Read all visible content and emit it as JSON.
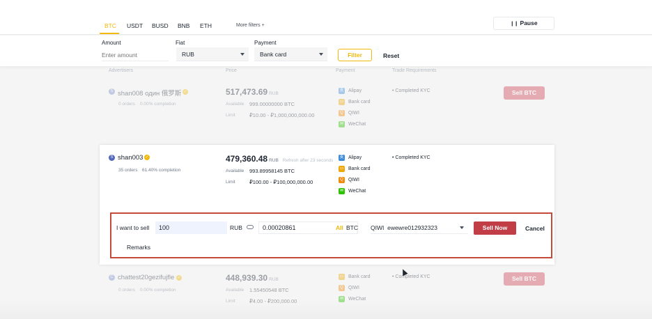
{
  "tabs": [
    "BTC",
    "USDT",
    "BUSD",
    "BNB",
    "ETH"
  ],
  "more_filters": "More filters",
  "pause_label": "Pause",
  "filters": {
    "amount_label": "Amount",
    "amount_placeholder": "Enter amount",
    "fiat_label": "Fiat",
    "fiat_value": "RUB",
    "payment_label": "Payment",
    "payment_value": "Bank card",
    "filter_btn": "Filter",
    "reset_btn": "Reset"
  },
  "columns": {
    "advertisers": "Advertisers",
    "price": "Price",
    "payment": "Payment",
    "trade_requirements": "Trade Requirements"
  },
  "labels": {
    "available": "Available",
    "limit": "Limit",
    "sell_btc": "Sell BTC"
  },
  "listings": [
    {
      "avatar": "S",
      "name": "shan008 один 俄罗斯",
      "orders": "0 orders",
      "completion": "0.00% completion",
      "price": "517,473.69",
      "unit": "RUB",
      "refresh": "",
      "available": "999.00000000 BTC",
      "limit": "₽10.00 - ₽1,000,000,000.00",
      "payments": [
        "Alipay",
        "Bank card",
        "QIWI",
        "WeChat"
      ],
      "requirement": "Completed KYC",
      "avatar_color": "#7b8ec9"
    },
    {
      "avatar": "S",
      "name": "shan003",
      "orders": "35 orders",
      "completion": "61.40% completion",
      "price": "479,360.48",
      "unit": "RUB",
      "refresh": "Refresh after 23 seconds",
      "available": "993.89958145 BTC",
      "limit": "₽100.00 - ₽100,000,000.00",
      "payments": [
        "Alipay",
        "Bank card",
        "QIWI",
        "WeChat"
      ],
      "requirement": "Completed KYC",
      "avatar_color": "#5466b8"
    },
    {
      "avatar": "C",
      "name": "chattest20gezifujfle",
      "orders": "0 orders",
      "completion": "0.00% completion",
      "price": "448,939.30",
      "unit": "RUB",
      "refresh": "",
      "available": "1.55450548 BTC",
      "limit": "₽4.00 - ₽200,000.00",
      "payments": [
        "Bank card",
        "QIWI",
        "WeChat"
      ],
      "requirement": "Completed KYC",
      "avatar_color": "#7b8ec9"
    }
  ],
  "order_panel": {
    "want_label": "I want to sell",
    "fiat_amount": "100",
    "fiat_unit": "RUB",
    "crypto_amount": "0.00020861",
    "all_label": "All",
    "crypto_unit": "BTC",
    "method": "QIWI",
    "account": "ewewre012932323",
    "sell_now": "Sell Now",
    "cancel": "Cancel",
    "remarks": "Remarks"
  },
  "colors": {
    "accent": "#f0b90b",
    "sell": "#c13e47",
    "highlight_border": "#c44b3c"
  }
}
